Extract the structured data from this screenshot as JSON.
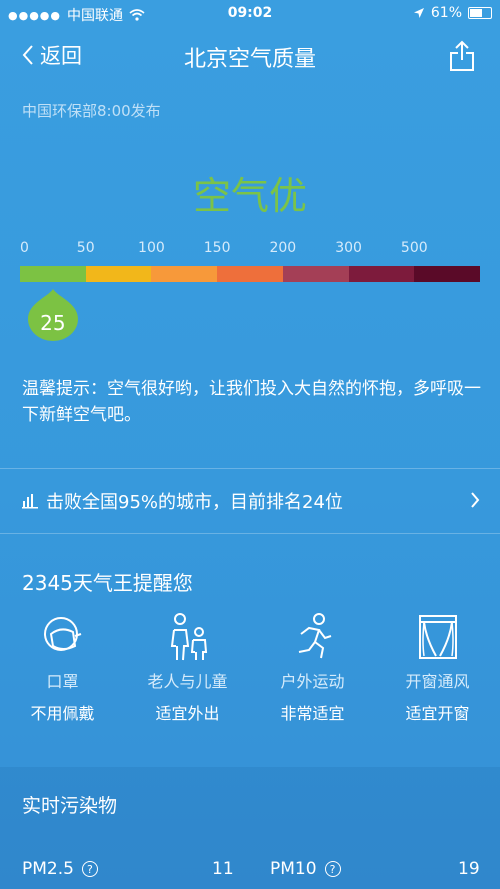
{
  "status_bar": {
    "carrier": "中国联通",
    "time": "09:02",
    "battery": "61%"
  },
  "nav": {
    "back_label": "返回",
    "title": "北京空气质量"
  },
  "publish_info": "中国环保部8:00发布",
  "quality_text": "空气优",
  "aqi": {
    "value": "25",
    "value_num": 25,
    "scale_labels": [
      "0",
      "50",
      "100",
      "150",
      "200",
      "300",
      "500"
    ],
    "segment_colors": [
      "#7cc243",
      "#f2b71a",
      "#f7993a",
      "#ee6f3b",
      "#a43f56",
      "#7d1b3c",
      "#5a0a28"
    ],
    "marker_color": "#7cc243"
  },
  "tip": "温馨提示：空气很好哟，让我们投入大自然的怀抱，多呼吸一下新鲜空气吧。",
  "rank_text": "击败全国95%的城市，目前排名24位",
  "remind": {
    "title": "2345天气王提醒您",
    "items": [
      {
        "label": "口罩",
        "value": "不用佩戴",
        "icon": "mask-icon"
      },
      {
        "label": "老人与儿童",
        "value": "适宜外出",
        "icon": "elderly-child-icon"
      },
      {
        "label": "户外运动",
        "value": "非常适宜",
        "icon": "running-icon"
      },
      {
        "label": "开窗通风",
        "value": "适宜开窗",
        "icon": "window-icon"
      }
    ]
  },
  "pollutants": {
    "title": "实时污染物",
    "items": [
      {
        "name": "PM2.5",
        "value": "11"
      },
      {
        "name": "PM10",
        "value": "19"
      }
    ]
  }
}
